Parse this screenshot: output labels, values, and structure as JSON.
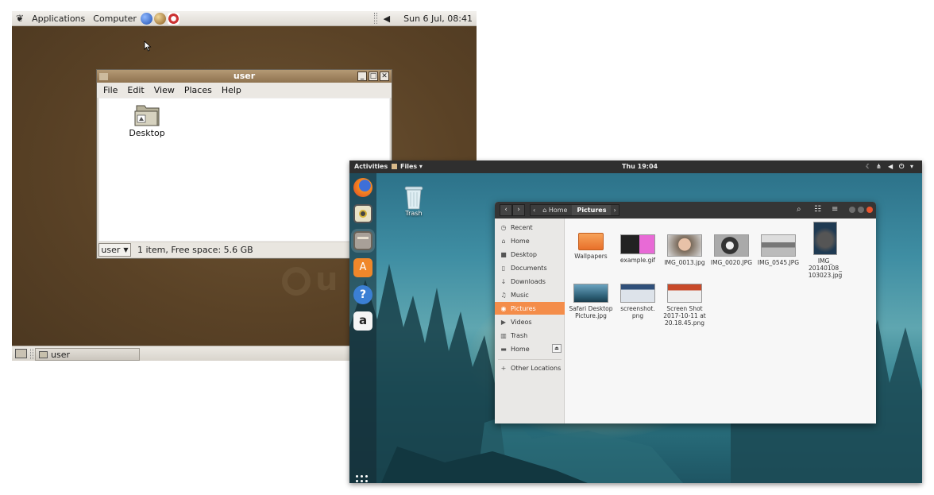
{
  "old": {
    "topbar": {
      "applications": "Applications",
      "computer": "Computer",
      "clock": "Sun  6 Jul, 08:41"
    },
    "window": {
      "title": "user",
      "menu": [
        "File",
        "Edit",
        "View",
        "Places",
        "Help"
      ],
      "icon_label": "Desktop",
      "location": "user",
      "status": "1 item, Free space: 5.6 GB"
    },
    "taskbar": {
      "task_label": "user"
    },
    "watermark": "u"
  },
  "new": {
    "topbar": {
      "activities": "Activities",
      "app_menu": "Files ▾",
      "clock": "Thu 19:04"
    },
    "desktop_icon": "Trash",
    "files": {
      "breadcrumb": {
        "home": "Home",
        "current": "Pictures"
      },
      "sidebar": [
        {
          "label": "Recent",
          "icon": "clock-icon"
        },
        {
          "label": "Home",
          "icon": "home-icon"
        },
        {
          "label": "Desktop",
          "icon": "folder-icon"
        },
        {
          "label": "Documents",
          "icon": "document-icon"
        },
        {
          "label": "Downloads",
          "icon": "download-icon"
        },
        {
          "label": "Music",
          "icon": "music-icon"
        },
        {
          "label": "Pictures",
          "icon": "camera-icon",
          "selected": true
        },
        {
          "label": "Videos",
          "icon": "video-icon"
        },
        {
          "label": "Trash",
          "icon": "trash-icon"
        },
        {
          "label": "Home",
          "icon": "drive-icon"
        }
      ],
      "other_locations": "Other Locations",
      "items": [
        {
          "name": "Wallpapers",
          "kind": "folder"
        },
        {
          "name": "example.gif",
          "kind": "image"
        },
        {
          "name": "IMG_0013.jpg",
          "kind": "image"
        },
        {
          "name": "IMG_0020.JPG",
          "kind": "image"
        },
        {
          "name": "IMG_0545.JPG",
          "kind": "image"
        },
        {
          "name": "IMG_ 20140108_ 103023.jpg",
          "kind": "image"
        },
        {
          "name": "Safari Desktop Picture.jpg",
          "kind": "image"
        },
        {
          "name": "screenshot. png",
          "kind": "image"
        },
        {
          "name": "Screen Shot 2017-10-11 at 20.18.45.png",
          "kind": "image"
        }
      ]
    }
  }
}
